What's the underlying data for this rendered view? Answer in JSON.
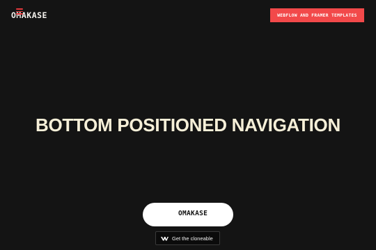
{
  "header": {
    "logo_text": "OMAKASE",
    "cta_label": "WEBFLOW AND FRAMER TEMPLATES"
  },
  "hero": {
    "title": "BOTTOM POSITIONED NAVIGATION"
  },
  "bottom_nav": {
    "menu_icon": "hamburger-menu-icon",
    "logo_text": "OMAKASE"
  },
  "cloneable": {
    "icon": "webflow-icon",
    "label": "Get the cloneable"
  },
  "colors": {
    "background": "#141414",
    "accent": "#f2494a",
    "hero_text": "#f6efd8",
    "pill_bg": "#ffffff"
  }
}
